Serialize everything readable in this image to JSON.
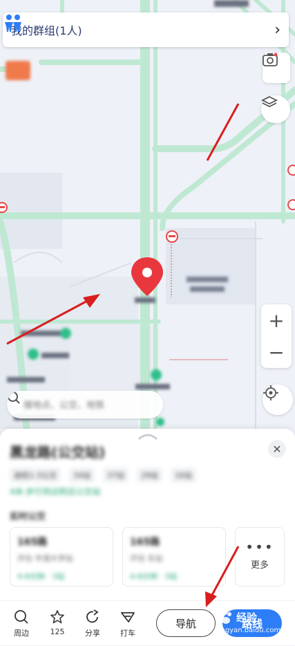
{
  "group_bar": {
    "label": "我的群组(1人)"
  },
  "map": {
    "search_placeholder": "搜地点、公交、地铁",
    "zoom_in": "+",
    "zoom_out": "−",
    "accent": "#2d7df6",
    "road_color": "#bfe8d3",
    "pin_color": "#e8383d"
  },
  "sheet": {
    "stop_name": "黑龙路(公交站)",
    "meta": [
      "途经1-3公交",
      "34站",
      "37站",
      "29站",
      "16站"
    ],
    "distance": "4米·步行到达附近公交站",
    "section_title": "实时公交",
    "bus_cards": [
      {
        "line": "165路",
        "direction": "开往 华清大学站",
        "eta": "4-6分钟 · 3站"
      },
      {
        "line": "165路",
        "direction": "开往 东站",
        "eta": "4-6分钟 · 3站"
      }
    ],
    "more_label": "更多"
  },
  "toolbar": {
    "nearby": "周边",
    "favorite_count": "125",
    "share": "分享",
    "taxi": "打车",
    "navigate": "导航",
    "route": "路线"
  },
  "watermark": {
    "main": "经验",
    "sub": "jingyan.baidu.com"
  }
}
